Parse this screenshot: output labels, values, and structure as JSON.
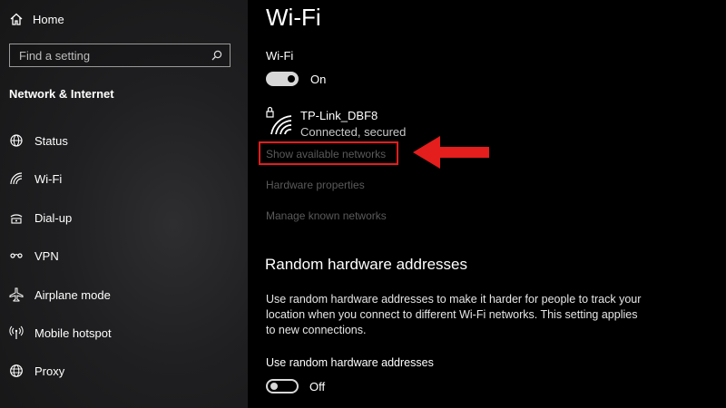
{
  "sidebar": {
    "home_label": "Home",
    "search_placeholder": "Find a setting",
    "section_title": "Network & Internet",
    "items": [
      {
        "label": "Status",
        "icon": "globe-status-icon"
      },
      {
        "label": "Wi-Fi",
        "icon": "wifi-icon"
      },
      {
        "label": "Dial-up",
        "icon": "dialup-icon"
      },
      {
        "label": "VPN",
        "icon": "vpn-icon"
      },
      {
        "label": "Airplane mode",
        "icon": "airplane-icon"
      },
      {
        "label": "Mobile hotspot",
        "icon": "hotspot-icon"
      },
      {
        "label": "Proxy",
        "icon": "globe-icon"
      }
    ]
  },
  "main": {
    "title": "Wi-Fi",
    "wifi_toggle": {
      "label": "Wi-Fi",
      "state": "On"
    },
    "network": {
      "name": "TP-Link_DBF8",
      "status": "Connected, secured"
    },
    "links": {
      "show_networks": "Show available networks",
      "hardware_properties": "Hardware properties",
      "manage_networks": "Manage known networks"
    },
    "random_hw": {
      "title": "Random hardware addresses",
      "description": "Use random hardware addresses to make it harder for people to track your location when you connect to different Wi-Fi networks. This setting applies to new connections.",
      "toggle_label": "Use random hardware addresses",
      "state": "Off"
    }
  },
  "colors": {
    "highlight": "#e41d1d",
    "link_disabled": "#5a5a5a"
  }
}
